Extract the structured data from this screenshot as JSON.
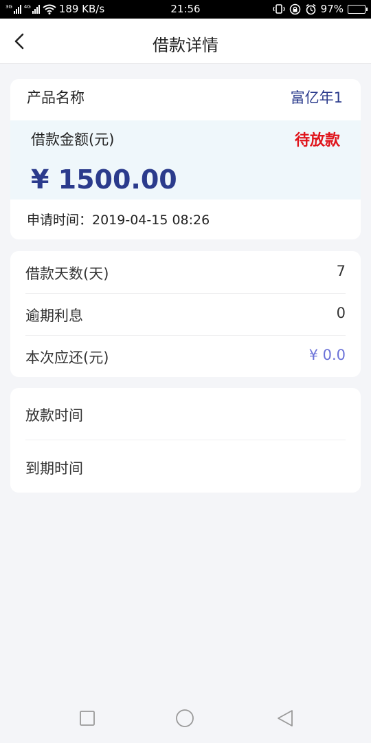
{
  "status_bar": {
    "net1": "3G",
    "net2": "4G",
    "speed": "189 KB/s",
    "time": "21:56",
    "battery": "97%"
  },
  "navbar": {
    "title": "借款详情"
  },
  "card1": {
    "product_label": "产品名称",
    "product_value": "富亿年1",
    "amount_label": "借款金额(元)",
    "status": "待放款",
    "amount": "¥ 1500.00",
    "apply_time": "申请时间：2019-04-15 08:26"
  },
  "card2": {
    "rows": [
      {
        "label": "借款天数(天)",
        "value": "7"
      },
      {
        "label": "逾期利息",
        "value": "0"
      },
      {
        "label": "本次应还(元)",
        "value": "¥ 0.0"
      }
    ]
  },
  "card3": {
    "rows": [
      {
        "label": "放款时间",
        "value": ""
      },
      {
        "label": "到期时间",
        "value": ""
      }
    ]
  },
  "colors": {
    "brand_blue": "#2b3b8c",
    "status_red": "#e0151c",
    "money_purple": "#6b72d8",
    "page_bg": "#f4f5f8"
  }
}
